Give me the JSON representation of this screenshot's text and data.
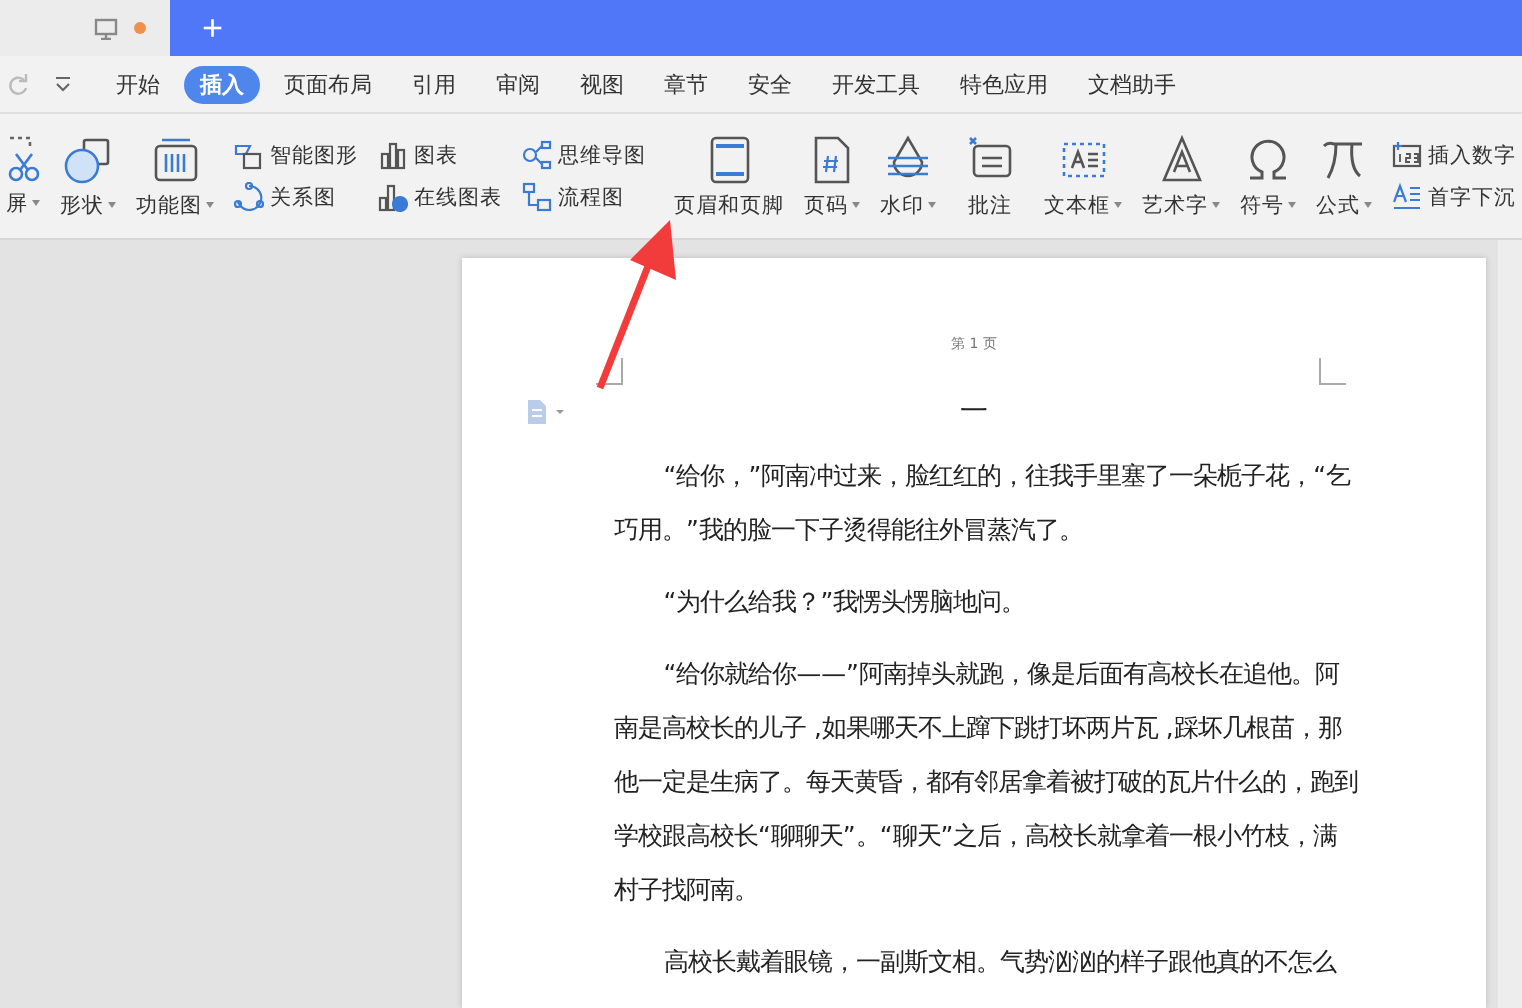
{
  "tab_bar": {
    "new_tab": "+",
    "unsaved": true
  },
  "menu_tabs": [
    {
      "label": "开始",
      "selected": false
    },
    {
      "label": "插入",
      "selected": true
    },
    {
      "label": "页面布局",
      "selected": false
    },
    {
      "label": "引用",
      "selected": false
    },
    {
      "label": "审阅",
      "selected": false
    },
    {
      "label": "视图",
      "selected": false
    },
    {
      "label": "章节",
      "selected": false
    },
    {
      "label": "安全",
      "selected": false
    },
    {
      "label": "开发工具",
      "selected": false
    },
    {
      "label": "特色应用",
      "selected": false
    },
    {
      "label": "文档助手",
      "selected": false
    }
  ],
  "ribbon_groups": [
    [
      {
        "kind": "large",
        "label": "屏",
        "dropdown": true
      },
      {
        "kind": "large",
        "label": "形状",
        "dropdown": true
      },
      {
        "kind": "large",
        "label": "功能图",
        "dropdown": true
      },
      {
        "kind": "small",
        "items": [
          {
            "label": "智能图形"
          },
          {
            "label": "关系图"
          }
        ]
      },
      {
        "kind": "small",
        "items": [
          {
            "label": "图表"
          },
          {
            "label": "在线图表"
          }
        ]
      },
      {
        "kind": "small",
        "items": [
          {
            "label": "思维导图"
          },
          {
            "label": "流程图"
          }
        ]
      }
    ],
    [
      {
        "kind": "large",
        "label": "页眉和页脚",
        "dropdown": false
      },
      {
        "kind": "large",
        "label": "页码",
        "dropdown": true
      },
      {
        "kind": "large",
        "label": "水印",
        "dropdown": true
      }
    ],
    [
      {
        "kind": "large",
        "label": "批注",
        "dropdown": false
      }
    ],
    [
      {
        "kind": "large",
        "label": "文本框",
        "dropdown": true
      },
      {
        "kind": "large",
        "label": "艺术字",
        "dropdown": true
      },
      {
        "kind": "large",
        "label": "符号",
        "dropdown": true
      },
      {
        "kind": "large",
        "label": "公式",
        "dropdown": true
      },
      {
        "kind": "small",
        "items": [
          {
            "label": "插入数字"
          },
          {
            "label": "首字下沉"
          }
        ]
      },
      {
        "kind": "icons"
      }
    ]
  ],
  "document": {
    "header": "第 1 页",
    "title": "一",
    "paragraphs": [
      "“给你，”阿南冲过来，脸红红的，往我手里塞了一朵栀子花，“乞巧用。”我的脸一下子烫得能往外冒蒸汽了。",
      "“为什么给我？”我愣头愣脑地问。",
      "“给你就给你——”阿南掉头就跑，像是后面有高校长在追他。阿南是高校长的儿子 ,如果哪天不上蹿下跳打坏两片瓦 ,踩坏几根苗，那他一定是生病了。每天黄昏，都有邻居拿着被打破的瓦片什么的，跑到学校跟高校长“聊聊天”。“聊天”之后，高校长就拿着一根小竹枝，满村子找阿南。",
      "高校长戴着眼镜，一副斯文相。气势汹汹的样子跟他真的不怎么"
    ]
  }
}
